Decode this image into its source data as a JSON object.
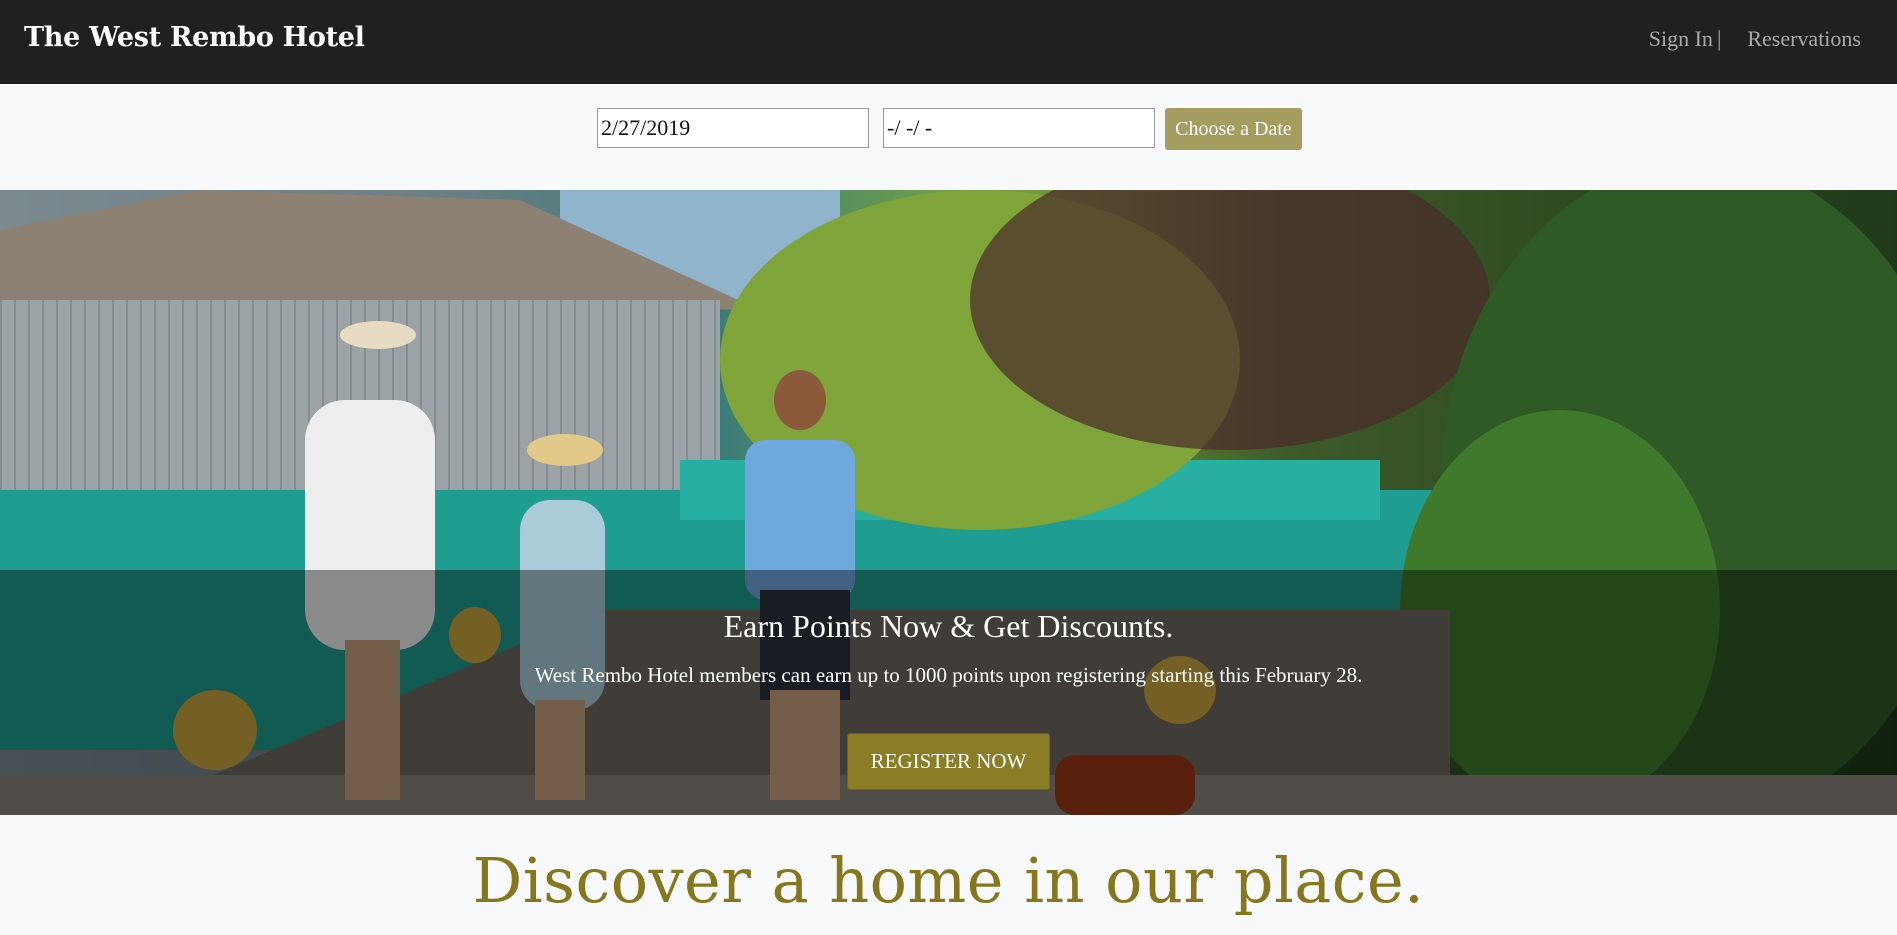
{
  "header": {
    "brand": "The West Rembo Hotel",
    "sign_in": "Sign In",
    "separator": "|",
    "reservations": "Reservations"
  },
  "booking": {
    "check_in_value": "2/27/2019",
    "check_out_value": "-/ -/ -",
    "choose_button": "Choose a Date"
  },
  "hero": {
    "title": "Earn Points Now & Get Discounts.",
    "subtitle": "West Rembo Hotel members can earn up to 1000 points upon registering starting this February 28.",
    "cta": "REGISTER NOW"
  },
  "section": {
    "heading": "Discover a home in our place."
  },
  "colors": {
    "navbar": "#202020",
    "accent": "#a59d60",
    "cta": "#8a7d25",
    "heading": "#86771d"
  }
}
